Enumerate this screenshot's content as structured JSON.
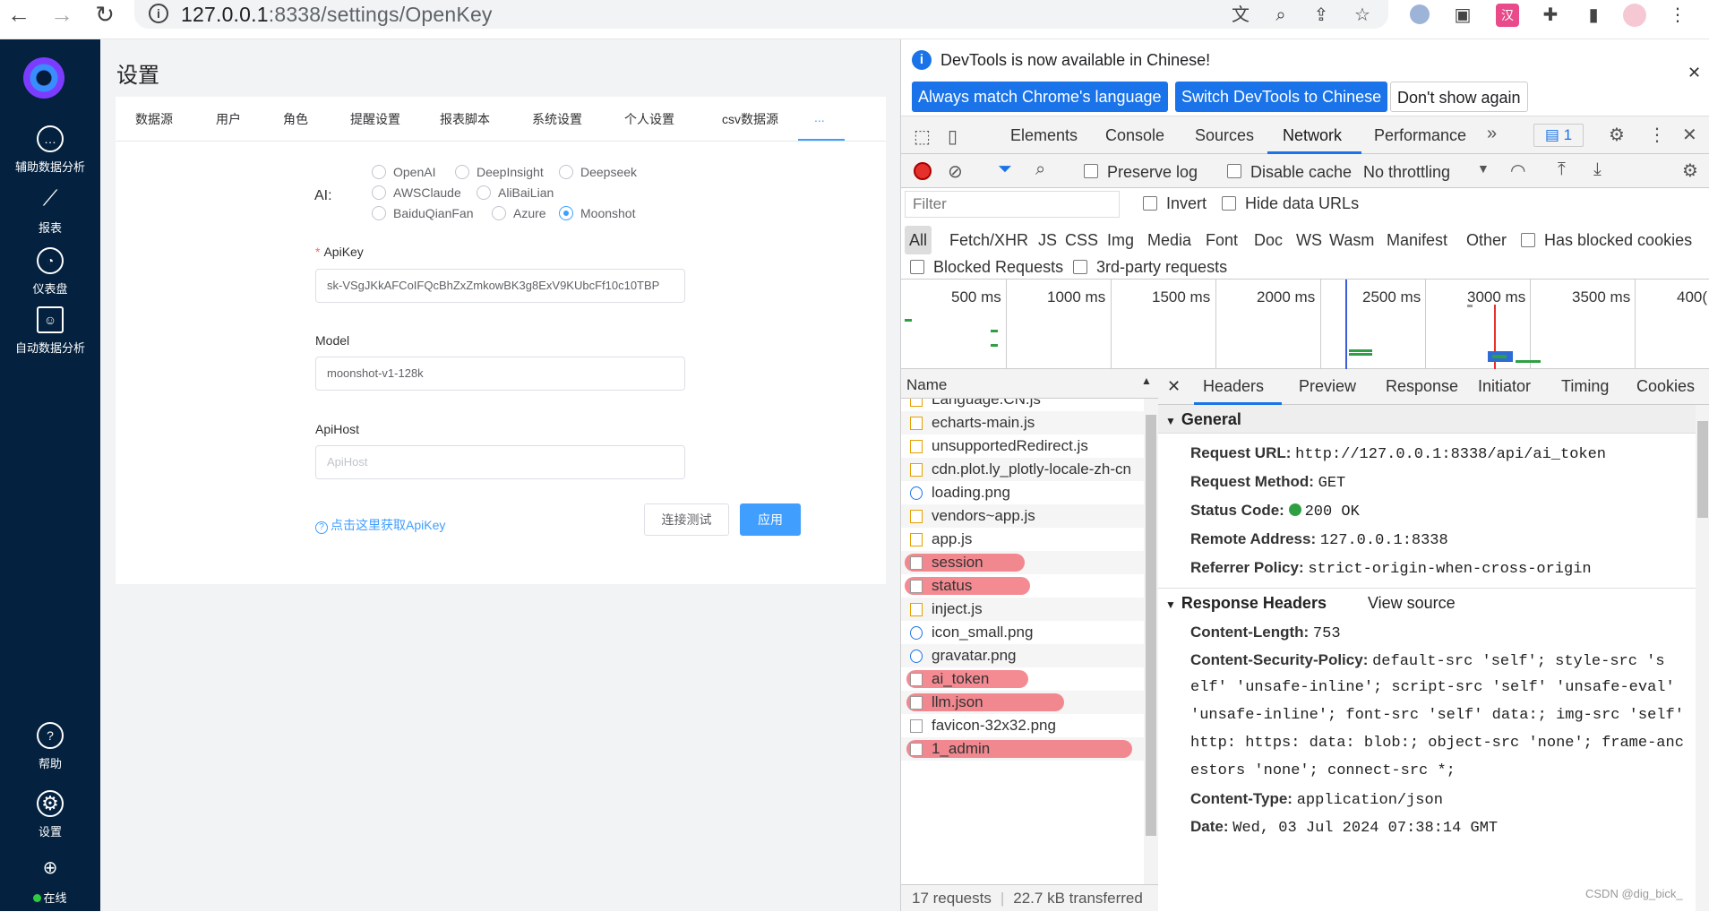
{
  "browser": {
    "url_host": "127.0.0.1",
    "url_port_path": ":8338/settings/OpenKey"
  },
  "sidebar": {
    "items": [
      {
        "label": "辅助数据分析",
        "icon": "chat-icon"
      },
      {
        "label": "报表",
        "icon": "line-chart-icon"
      },
      {
        "label": "仪表盘",
        "icon": "gauge-icon"
      },
      {
        "label": "自动数据分析",
        "icon": "robot-icon"
      }
    ],
    "bottom": [
      {
        "label": "帮助",
        "icon": "help-icon"
      },
      {
        "label": "设置",
        "icon": "gear-icon"
      },
      {
        "label": "在线",
        "icon": "globe-icon"
      }
    ]
  },
  "page": {
    "title": "设置",
    "tabs": [
      "数据源",
      "用户",
      "角色",
      "提醒设置",
      "报表脚本",
      "系统设置",
      "个人设置",
      "csv数据源",
      "..."
    ],
    "ai_label": "AI:",
    "providers": [
      "OpenAI",
      "DeepInsight",
      "Deepseek",
      "AWSClaude",
      "AliBaiLian",
      "BaiduQianFan",
      "Azure",
      "Moonshot"
    ],
    "selected_provider": "Moonshot",
    "apikey_label": "ApiKey",
    "apikey_value": "sk-VSgJKkAFCoIFQcBhZxZmkowBK3g8ExV9KUbcFf10c10TBP",
    "model_label": "Model",
    "model_value": "moonshot-v1-128k",
    "apihost_label": "ApiHost",
    "apihost_placeholder": "ApiHost",
    "get_key_link": "点击这里获取ApiKey",
    "test_button": "连接测试",
    "apply_button": "应用"
  },
  "devtools": {
    "banner_text": "DevTools is now available in Chinese!",
    "banner_btn1": "Always match Chrome's language",
    "banner_btn2": "Switch DevTools to Chinese",
    "banner_btn3": "Don't show again",
    "tabs": [
      "Elements",
      "Console",
      "Sources",
      "Network",
      "Performance"
    ],
    "active_tab": "Network",
    "issues_count": "1",
    "preserve_log": "Preserve log",
    "disable_cache": "Disable cache",
    "throttling": "No throttling",
    "filter_placeholder": "Filter",
    "invert": "Invert",
    "hide_data_urls": "Hide data URLs",
    "type_filters": [
      "All",
      "Fetch/XHR",
      "JS",
      "CSS",
      "Img",
      "Media",
      "Font",
      "Doc",
      "WS",
      "Wasm",
      "Manifest",
      "Other"
    ],
    "has_blocked_cookies": "Has blocked cookies",
    "blocked_requests": "Blocked Requests",
    "third_party": "3rd-party requests",
    "timeline_labels": [
      "500 ms",
      "1000 ms",
      "1500 ms",
      "2000 ms",
      "2500 ms",
      "3000 ms",
      "3500 ms",
      "400("
    ],
    "name_header": "Name",
    "requests": [
      {
        "name": "Language.CN.js",
        "type": "js"
      },
      {
        "name": "echarts-main.js",
        "type": "js"
      },
      {
        "name": "unsupportedRedirect.js",
        "type": "js"
      },
      {
        "name": "cdn.plot.ly_plotly-locale-zh-cn",
        "type": "js"
      },
      {
        "name": "loading.png",
        "type": "img"
      },
      {
        "name": "vendors~app.js",
        "type": "js"
      },
      {
        "name": "app.js",
        "type": "js"
      },
      {
        "name": "session",
        "type": "xhr"
      },
      {
        "name": "status",
        "type": "xhr"
      },
      {
        "name": "inject.js",
        "type": "js"
      },
      {
        "name": "icon_small.png",
        "type": "img"
      },
      {
        "name": "gravatar.png",
        "type": "img"
      },
      {
        "name": "ai_token",
        "type": "xhr"
      },
      {
        "name": "llm.json",
        "type": "xhr"
      },
      {
        "name": "favicon-32x32.png",
        "type": "doc"
      },
      {
        "name": "1_admin",
        "type": "xhr"
      }
    ],
    "status_requests": "17 requests",
    "status_transferred": "22.7 kB transferred",
    "detail_tabs": [
      "Headers",
      "Preview",
      "Response",
      "Initiator",
      "Timing",
      "Cookies"
    ],
    "general_title": "General",
    "general": [
      {
        "k": "Request URL:",
        "v": "http://127.0.0.1:8338/api/ai_token"
      },
      {
        "k": "Request Method:",
        "v": "GET"
      },
      {
        "k": "Status Code:",
        "v": "200 OK"
      },
      {
        "k": "Remote Address:",
        "v": "127.0.0.1:8338"
      },
      {
        "k": "Referrer Policy:",
        "v": "strict-origin-when-cross-origin"
      }
    ],
    "response_headers_title": "Response Headers",
    "view_source": "View source",
    "content_length_k": "Content-Length:",
    "content_length_v": "753",
    "csp_k": "Content-Security-Policy:",
    "csp_lines": [
      "default-src 'self'; style-src 's",
      "elf' 'unsafe-inline'; script-src 'self' 'unsafe-eval'",
      "'unsafe-inline'; font-src 'self' data:; img-src 'self'",
      "http: https: data: blob:; object-src 'none'; frame-anc",
      "estors 'none'; connect-src *;"
    ],
    "content_type_k": "Content-Type:",
    "content_type_v": "application/json",
    "date_k": "Date:",
    "date_v": "Wed, 03 Jul 2024 07:38:14 GMT"
  },
  "watermark": "CSDN @dig_bick_"
}
